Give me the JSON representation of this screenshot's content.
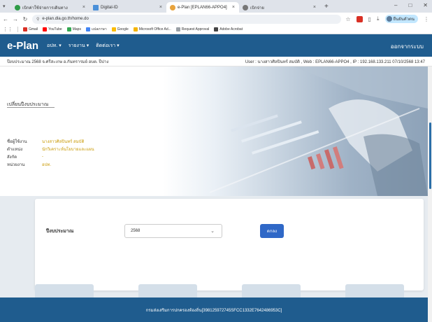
{
  "browser": {
    "tabs": [
      {
        "label": "เบิกค่าใช้จ่ายการเดินทาง",
        "active": false,
        "icon": "green-app-icon"
      },
      {
        "label": "Digital-ID",
        "active": false,
        "icon": "doc-icon"
      },
      {
        "label": "e-Plan [EPLAN66-APPO4]",
        "active": true,
        "icon": "eplan-icon"
      },
      {
        "label": "เบิกจ่าย",
        "active": false,
        "icon": "globe-icon"
      }
    ],
    "url": "e-plan.dla.go.th/home.do",
    "bookmarks": [
      {
        "label": "Gmail",
        "color": "#d93025"
      },
      {
        "label": "YouTube",
        "color": "#ff0000"
      },
      {
        "label": "Maps",
        "color": "#34a853"
      },
      {
        "label": "แปลภาษา",
        "color": "#4285f4"
      },
      {
        "label": "Google",
        "color": "#fbbc05"
      },
      {
        "label": "Microsoft Office Ad...",
        "color": "#f4b400"
      },
      {
        "label": "Request Approval",
        "color": "#9aa0a6"
      },
      {
        "label": "Adobe Acrobat",
        "color": "#444444"
      }
    ],
    "profile_label": "ยืนยันตัวตน"
  },
  "app": {
    "brand": "e-Plan",
    "menu": [
      "อปท.",
      "รายงาน",
      "ติดต่อเรา"
    ],
    "logout": "ออกจากระบบ",
    "info_left": "ปีงบประมาณ 2568  จ.ศรีสะเกษ อ.กันทรารมย์ อบต. ปีปาง",
    "info_right": "User : นางสาวศิลปินทร์ สมบัติ , Web : EPLAN66-APPO4 , IP : 192.168.133.211 07/10/2568 13:47"
  },
  "hero": {
    "title": "เปลี่ยนปีงบประมาณ",
    "fields": [
      {
        "label": "ชื่อผู้ใช้งาน",
        "value": "นางสาวศิลปินทร์ สมบัติ"
      },
      {
        "label": "ตำแหน่ง",
        "value": "นักวิเคราะห์นโยบายและแผน"
      },
      {
        "label": "สังกัด",
        "value": "-"
      },
      {
        "label": "หน่วยงาน",
        "value": "อปท."
      }
    ]
  },
  "form": {
    "budget_label": "ปีงบประมาณ",
    "budget_value": "2568",
    "ok_label": "ตกลง"
  },
  "footer": {
    "text": "กรมส่งเสริมการปกครองท้องถิ่น[398125972745SFCC1332E7642486953C]"
  },
  "colors": {
    "header_bg": "#1f5c8e",
    "field_value": "#c99a06",
    "button": "#2f68c7"
  }
}
